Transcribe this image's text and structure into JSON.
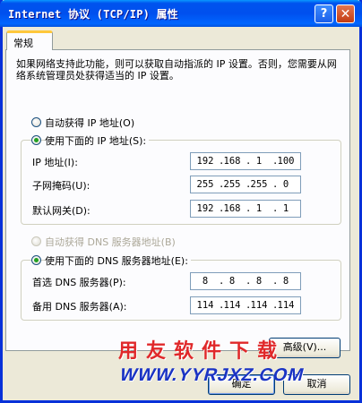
{
  "window": {
    "title": "Internet 协议 (TCP/IP) 属性",
    "help_glyph": "?",
    "close_glyph": "✕"
  },
  "tabs": [
    {
      "label": "常规"
    }
  ],
  "intro_text": "如果网络支持此功能，则可以获取自动指派的 IP 设置。否则，您需要从网络系统管理员处获得适当的 IP 设置。",
  "ip_section": {
    "auto_label": "自动获得 IP 地址(O)",
    "manual_label": "使用下面的 IP 地址(S):",
    "selected": "manual",
    "fields": [
      {
        "label": "IP 地址(I):",
        "octets": [
          "192",
          "168",
          "1",
          "100"
        ]
      },
      {
        "label": "子网掩码(U):",
        "octets": [
          "255",
          "255",
          "255",
          "0"
        ]
      },
      {
        "label": "默认网关(D):",
        "octets": [
          "192",
          "168",
          "1",
          "1"
        ]
      }
    ]
  },
  "dns_section": {
    "auto_label": "自动获得 DNS 服务器地址(B)",
    "manual_label": "使用下面的 DNS 服务器地址(E):",
    "selected": "manual",
    "fields": [
      {
        "label": "首选 DNS 服务器(P):",
        "octets": [
          "8",
          "8",
          "8",
          "8"
        ]
      },
      {
        "label": "备用 DNS 服务器(A):",
        "octets": [
          "114",
          "114",
          "114",
          "114"
        ]
      }
    ]
  },
  "buttons": {
    "advanced": "高级(V)...",
    "ok": "确定",
    "cancel": "取消"
  },
  "watermark": {
    "cn_text": "用友软件下载",
    "url_text": "WWW.YYRJXZ.COM"
  },
  "colors": {
    "titlebar": "#0053ee",
    "window_bg": "#ece9d8",
    "tab_accent": "#ffc83c",
    "radio_selected": "#21a121",
    "watermark_red": "#e0282a",
    "watermark_blue": "#1a33c4"
  },
  "icons": {
    "help": "help-icon",
    "close": "close-icon"
  }
}
